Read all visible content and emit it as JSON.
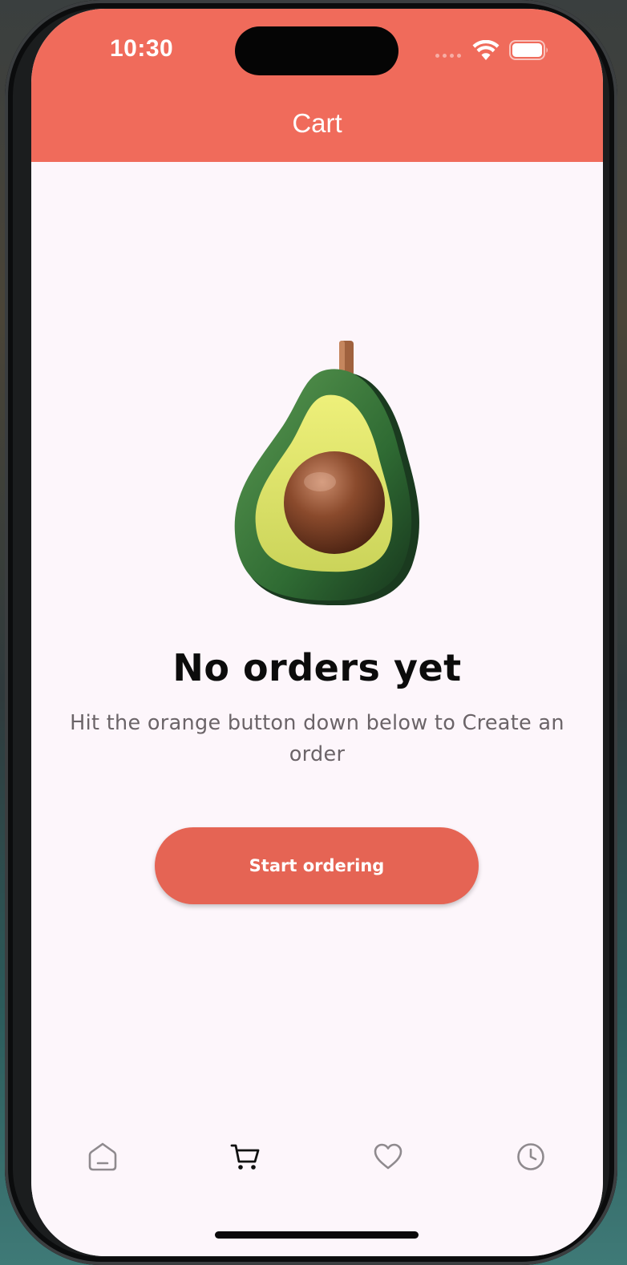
{
  "status_bar": {
    "time": "10:30"
  },
  "header": {
    "title": "Cart"
  },
  "empty_state": {
    "illustration": "avocado-illustration",
    "title": "No orders yet",
    "subtitle": "Hit the orange button down below to Create an order"
  },
  "actions": {
    "start_ordering_label": "Start ordering"
  },
  "bottom_nav": {
    "items": [
      {
        "icon": "home-icon",
        "active": false
      },
      {
        "icon": "cart-icon",
        "active": true
      },
      {
        "icon": "heart-icon",
        "active": false
      },
      {
        "icon": "clock-icon",
        "active": false
      }
    ]
  },
  "colors": {
    "header": "#f06b5b",
    "button": "#e56454",
    "background": "#fdf6fb",
    "nav_active": "#111111",
    "nav_inactive": "#8f8a8e"
  }
}
